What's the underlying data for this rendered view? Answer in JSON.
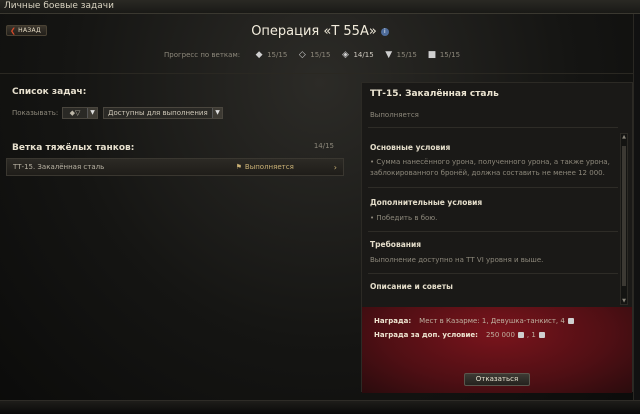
{
  "window": {
    "title": "Личные боевые задачи"
  },
  "header": {
    "back_label": "НАЗАД",
    "operation_title": "Операция «Т 55А»",
    "info_icon": "i",
    "progress_label": "Прогресс по веткам:",
    "progress": [
      {
        "icon": "medium-tank-icon",
        "value": "15/15",
        "highlight": false
      },
      {
        "icon": "light-tank-icon",
        "value": "15/15",
        "highlight": false
      },
      {
        "icon": "heavy-tank-icon",
        "value": "14/15",
        "highlight": true
      },
      {
        "icon": "td-icon",
        "value": "15/15",
        "highlight": false
      },
      {
        "icon": "spg-icon",
        "value": "15/15",
        "highlight": false
      }
    ]
  },
  "left": {
    "title": "Список задач:",
    "filter_label": "Показывать:",
    "filter_value": "Доступны для выполнения",
    "branch_title": "Ветка тяжёлых танков:",
    "count": "14/15",
    "tasks": [
      {
        "name": "ТТ-15. Закалённая сталь",
        "status": "Выполняется"
      }
    ]
  },
  "detail": {
    "title": "ТТ-15. Закалённая сталь",
    "status": "Выполняется",
    "main_h": "Основные условия",
    "main_t": "• Сумма нанесённого урона, полученного урона, а также урона, заблокированного бронёй, должна составить не менее 12 000.",
    "extra_h": "Дополнительные условия",
    "extra_t": "• Победить в бою.",
    "req_h": "Требования",
    "req_t": "Выполнение доступно на ТТ VI уровня и выше.",
    "desc_h": "Описание и советы",
    "reward_label": "Награда:",
    "reward_value": "Мест в Казарме: 1, Девушка-танкист, 4",
    "reward_extra_label": "Награда за доп. условие:",
    "reward_extra_value": "250 000",
    "reward_extra_tail": ", 1",
    "decline_label": "Отказаться"
  }
}
